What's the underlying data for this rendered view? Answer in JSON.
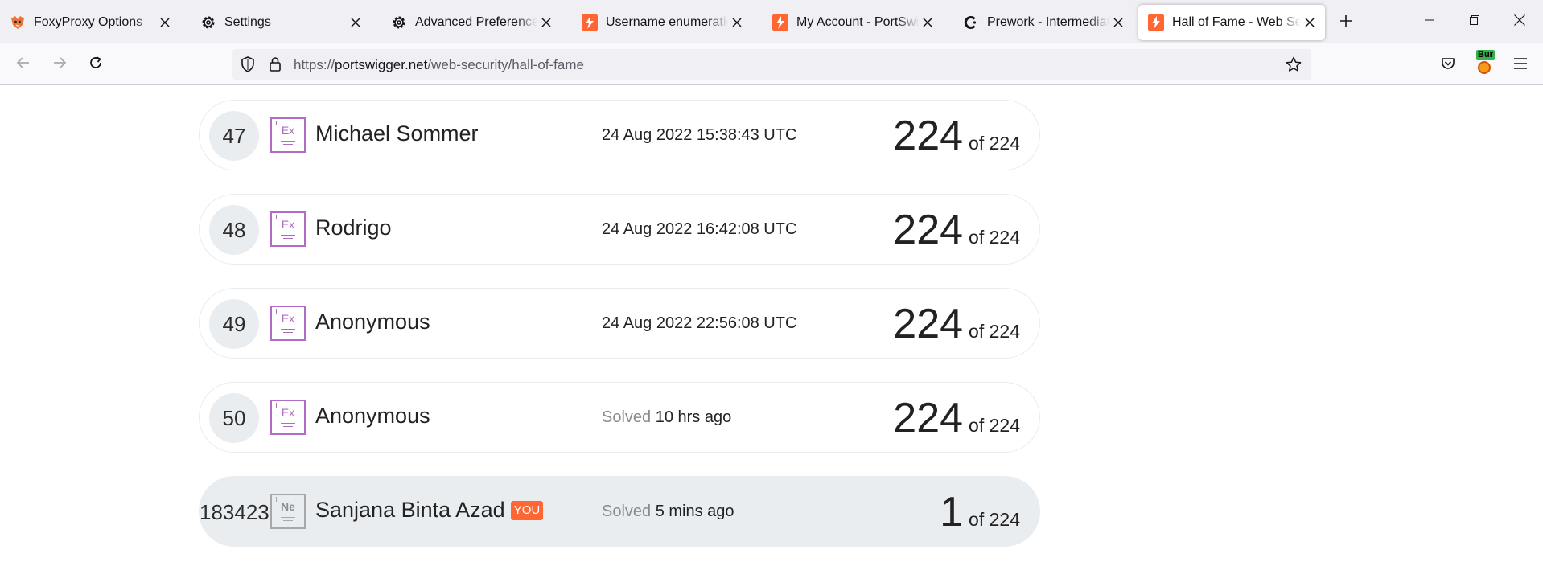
{
  "browser": {
    "tabs": [
      {
        "title": "FoxyProxy Options",
        "favicon": "foxyproxy-icon",
        "active": false
      },
      {
        "title": "Settings",
        "favicon": "gear-icon",
        "active": false
      },
      {
        "title": "Advanced Preferences",
        "favicon": "gear-icon",
        "active": false
      },
      {
        "title": "Username enumeration v",
        "favicon": "portswigger-icon",
        "active": false
      },
      {
        "title": "My Account - PortSwigge",
        "favicon": "portswigger-icon",
        "active": false
      },
      {
        "title": "Prework - Intermediate C",
        "favicon": "codepath-icon",
        "active": false
      },
      {
        "title": "Hall of Fame - Web Secu",
        "favicon": "portswigger-icon",
        "active": true
      }
    ],
    "url": {
      "scheme": "https://",
      "host": "portswigger.net",
      "path": "/web-security/hall-of-fame"
    },
    "burp_badge": "Bur",
    "accent": "#ff6633"
  },
  "hall_of_fame": {
    "rows": [
      {
        "rank": "47",
        "level_code": "Ex",
        "name": "Michael Sommer",
        "when_prefix": "",
        "when": "24 Aug 2022 15:38:43 UTC",
        "solved": "224",
        "of": "of 224"
      },
      {
        "rank": "48",
        "level_code": "Ex",
        "name": "Rodrigo",
        "when_prefix": "",
        "when": "24 Aug 2022 16:42:08 UTC",
        "solved": "224",
        "of": "of 224"
      },
      {
        "rank": "49",
        "level_code": "Ex",
        "name": "Anonymous",
        "when_prefix": "",
        "when": "24 Aug 2022 22:56:08 UTC",
        "solved": "224",
        "of": "of 224"
      },
      {
        "rank": "50",
        "level_code": "Ex",
        "name": "Anonymous",
        "when_prefix": "Solved",
        "when": "10 hrs ago",
        "solved": "224",
        "of": "of 224"
      }
    ],
    "current_user": {
      "rank": "183423",
      "level_code": "Ne",
      "name": "Sanjana Binta Azad",
      "badge": "YOU",
      "when_prefix": "Solved",
      "when": "5 mins ago",
      "solved": "1",
      "of": "of 224"
    }
  }
}
